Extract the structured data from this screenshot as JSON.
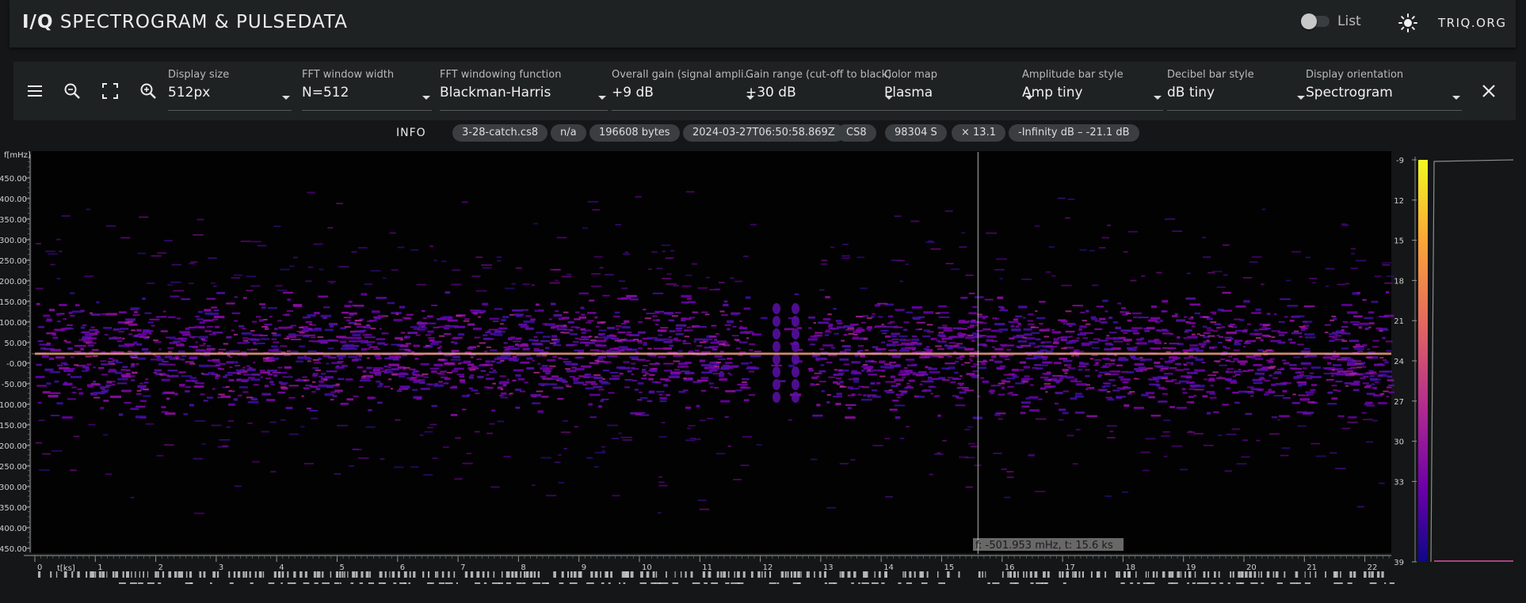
{
  "header": {
    "title_bold": "I/Q",
    "title_rest": " SPECTROGRAM & PULSEDATA",
    "list_label": "List",
    "brand": "TRIQ.ORG"
  },
  "toolbar": {
    "fields": [
      {
        "label": "Display size",
        "value": "512px"
      },
      {
        "label": "FFT window width",
        "value": "N=512"
      },
      {
        "label": "FFT windowing function",
        "value": "Blackman-Harris"
      },
      {
        "label": "Overall gain (signal ampli...",
        "value": "+9 dB"
      },
      {
        "label": "Gain range (cut-off to black)",
        "value": "+30 dB"
      },
      {
        "label": "Color map",
        "value": "Plasma"
      },
      {
        "label": "Amplitude bar style",
        "value": "Amp tiny"
      },
      {
        "label": "Decibel bar style",
        "value": "dB tiny"
      },
      {
        "label": "Display orientation",
        "value": "Spectrogram"
      }
    ]
  },
  "info": {
    "label": "INFO",
    "chips": [
      "3-28-catch.cs8",
      "n/a",
      "196608 bytes",
      "2024-03-27T06:50:58.869Z",
      "CS8",
      "98304 S",
      "× 13.1",
      "-Infinity dB – -21.1 dB"
    ]
  },
  "spectrogram": {
    "freq_unit_label": "f[mHz]",
    "time_unit_label": "t[ks]",
    "freq_ticks": [
      "450.00",
      "400.00",
      "350.00",
      "300.00",
      "250.00",
      "200.00",
      "150.00",
      "100.00",
      "50.00",
      "-0.00",
      "-50.00",
      "-100.00",
      "-150.00",
      "-200.00",
      "-250.00",
      "-300.00",
      "-350.00",
      "-400.00",
      "-450.00"
    ],
    "time_ticks": [
      "0",
      "1",
      "2",
      "3",
      "4",
      "5",
      "6",
      "7",
      "8",
      "9",
      "10",
      "11",
      "12",
      "13",
      "14",
      "15",
      "16",
      "17",
      "18",
      "19",
      "20",
      "21",
      "22"
    ],
    "cursor_readout": "f: -501.953 mHz, t: 15.6 ks",
    "cursor_time_ks": 15.6,
    "cursor_freq_mhz": -501.953
  },
  "db_scale": {
    "ticks": [
      "-9",
      "-12",
      "-15",
      "-18",
      "-21",
      "-24",
      "-27",
      "-30",
      "-33",
      "-39"
    ],
    "colormap": "Plasma"
  },
  "colors": {
    "background": "#141617",
    "panel": "#1f2223",
    "chip": "#3a3e40",
    "amp_line": "#a8437e"
  }
}
